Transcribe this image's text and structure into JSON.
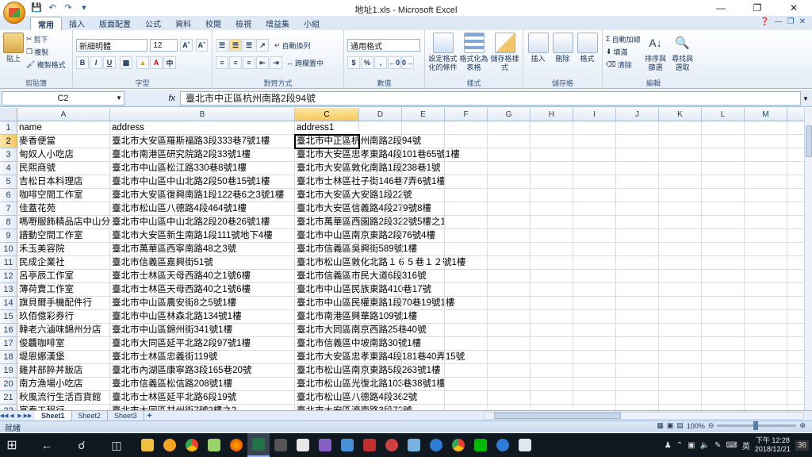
{
  "window": {
    "title": "地址1.xls - Microsoft Excel"
  },
  "tabs": [
    "常用",
    "插入",
    "版面配置",
    "公式",
    "資料",
    "校閱",
    "檢視",
    "增益集",
    "小組"
  ],
  "ribbon": {
    "clipboard": {
      "label": "剪貼簿",
      "paste": "貼上",
      "cut": "剪下",
      "copy": "複製",
      "format_painter": "複製格式"
    },
    "font": {
      "label": "字型",
      "font_name": "新細明體",
      "font_size": "12",
      "bold": "B",
      "italic": "I",
      "underline": "U"
    },
    "alignment": {
      "label": "對齊方式",
      "wrap": "自動換列",
      "merge": "跨欄置中"
    },
    "number": {
      "label": "數值",
      "format": "通用格式",
      "currency": "$",
      "percent": "%",
      "comma": ","
    },
    "styles": {
      "label": "樣式",
      "conditional": "設定格式化的條件",
      "table": "格式化為表格",
      "cell_styles": "儲存格樣式"
    },
    "cells": {
      "label": "儲存格",
      "insert": "插入",
      "delete": "刪除",
      "format": "格式"
    },
    "editing": {
      "label": "編輯",
      "autosum": "自動加總",
      "fill": "填滿",
      "clear": "清除",
      "sort": "排序與篩選",
      "find": "尋找與選取"
    }
  },
  "formula_bar": {
    "name_box": "C2",
    "fx": "fx",
    "content": "臺北市中正區杭州南路2段94號"
  },
  "columns": [
    "A",
    "B",
    "C",
    "D",
    "E",
    "F",
    "G",
    "H",
    "I",
    "J",
    "K",
    "L",
    "M",
    "N"
  ],
  "rows": [
    {
      "n": "1",
      "a": "name",
      "b": "address",
      "c": "address1"
    },
    {
      "n": "2",
      "a": "麥香便當",
      "b": "臺北市大安區羅斯福路3段333巷7號1樓",
      "c": "臺北市中正區杭州南路2段94號"
    },
    {
      "n": "3",
      "a": "甸奴人小吃店",
      "b": "臺北市南港區研究院路2段33號1樓",
      "c": "臺北市大安區忠孝東路4段101巷65號1樓"
    },
    {
      "n": "4",
      "a": "民熙商號",
      "b": "臺北市中山區松江路330巷8號1樓",
      "c": "臺北市大安區敦化南路1段238巷1號"
    },
    {
      "n": "5",
      "a": "吉松日本料理店",
      "b": "臺北市中山區中山北路2段50巷15號1樓",
      "c": "臺北市士林區社子街146巷7弄6號1樓"
    },
    {
      "n": "6",
      "a": "咖啡空間工作室",
      "b": "臺北市大安區復興南路1段122巷6之3號1樓",
      "c": "臺北市大安區大安路1段22號"
    },
    {
      "n": "7",
      "a": "佳蓋花苑",
      "b": "臺北市松山區八德路4段464號1樓",
      "c": "臺北市大安區信義路4段279號8樓"
    },
    {
      "n": "8",
      "a": "嗎嘢服飾精品店中山分店",
      "b": "臺北市中山區中山北路2段20巷26號1樓",
      "c": "臺北市萬華區西園路2段322號5樓之1"
    },
    {
      "n": "9",
      "a": "譜動空間工作室",
      "b": "臺北市大安區新生南路1段111號地下4樓",
      "c": "臺北市中山區南京東路2段76號4樓"
    },
    {
      "n": "10",
      "a": "禾玉美容院",
      "b": "臺北市萬華區西寧南路48之3號",
      "c": "臺北市信義區吳興街589號1樓"
    },
    {
      "n": "11",
      "a": "民成企業社",
      "b": "臺北市信義區嘉興街51號",
      "c": "臺北市松山區敦化北路１６５巷１２號1樓"
    },
    {
      "n": "12",
      "a": "呂亭辰工作室",
      "b": "臺北市士林區天母西路40之1號6樓",
      "c": "臺北市信義區市民大道6段316號"
    },
    {
      "n": "13",
      "a": "薄荷賣工作室",
      "b": "臺北市士林區天母西路40之1號6樓",
      "c": "臺北市中山區民族東路410巷17號"
    },
    {
      "n": "14",
      "a": "旗貝爾手機配件行",
      "b": "臺北市中山區農安街8之5號1樓",
      "c": "臺北市中山區民權東路1段70巷19號1樓"
    },
    {
      "n": "15",
      "a": "玖佰億彩券行",
      "b": "臺北市中山區林森北路134號1樓",
      "c": "臺北市南港區興華路109號1樓"
    },
    {
      "n": "16",
      "a": "韓老六滷味錦州分店",
      "b": "臺北市中山區錦州街341號1樓",
      "c": "臺北市大同區南京西路25巷40號"
    },
    {
      "n": "17",
      "a": "俊龘咖啡室",
      "b": "臺北市大同區延平北路2段97號1樓",
      "c": "臺北市信義區中坡南路30號1樓"
    },
    {
      "n": "18",
      "a": "堤恩娜漢堡",
      "b": "臺北市士林區忠義街119號",
      "c": "臺北市大安區忠孝東路4段181巷40弄15號"
    },
    {
      "n": "19",
      "a": "雞丼部脺丼飯店",
      "b": "臺北市內湖區康寧路3段165巷20號",
      "c": "臺北市松山區南京東路5段263號1樓"
    },
    {
      "n": "20",
      "a": "南方漁場小吃店",
      "b": "臺北市信義區松信路208號1樓",
      "c": "臺北市松山區光復北路103巷38號1樓"
    },
    {
      "n": "21",
      "a": "秋風流行生活百貨館",
      "b": "臺北市士林區延平北路6段19號",
      "c": "臺北市松山區八德路4段362號"
    },
    {
      "n": "22",
      "a": "富泰工程行",
      "b": "臺北市大同區甘州街7號2樓之2",
      "c": "臺北市大安區濟南路3段72號"
    }
  ],
  "sheets": [
    "Sheet1",
    "Sheet2",
    "Sheet3"
  ],
  "status": {
    "ready": "就緒",
    "zoom": "100%"
  },
  "taskbar": {
    "clock_time": "下午 12:28",
    "clock_date": "2018/12/21",
    "ime": "英",
    "notifications": "36"
  },
  "colors": {
    "excel_green": "#217346",
    "selection_header": "#f7c85a",
    "ribbon_blue": "#dfe9f5"
  }
}
